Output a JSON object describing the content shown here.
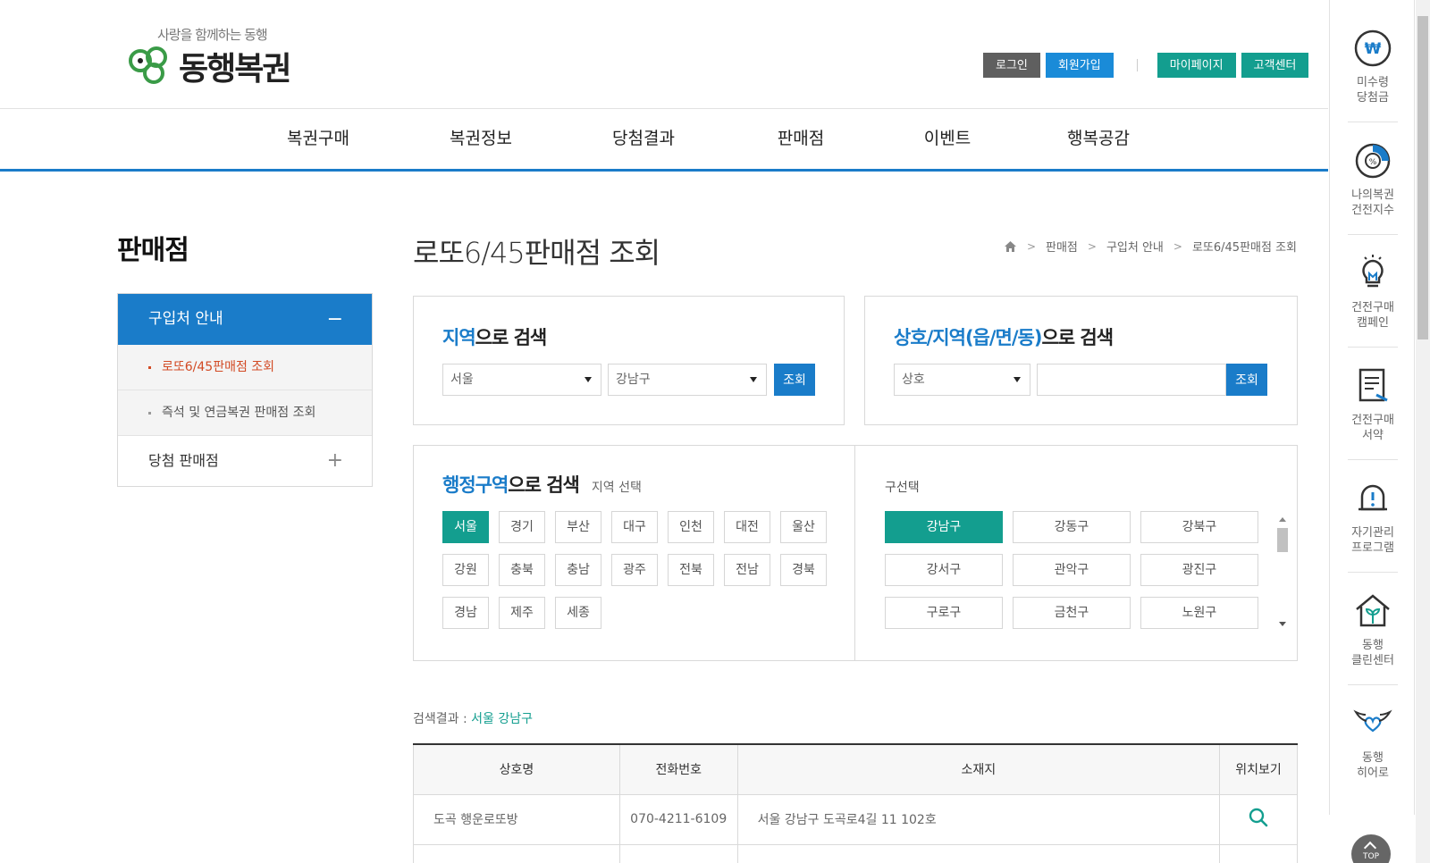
{
  "header": {
    "logo": {
      "slogan": "사랑을 함께하는 동행",
      "name": "동행복권"
    },
    "util": {
      "login": "로그인",
      "signup": "회원가입",
      "mypage": "마이페이지",
      "support": "고객센터"
    },
    "gnb": [
      "복권구매",
      "복권정보",
      "당첨결과",
      "판매점",
      "이벤트",
      "행복공감"
    ]
  },
  "sidebar": {
    "title": "판매점",
    "menu": {
      "head": "구입처 안내",
      "head_toggle": "−",
      "sub": [
        "로또6/45판매점 조회",
        "즉석 및 연금복권 판매점 조회"
      ],
      "row": "당첨 판매점",
      "row_toggle": "+"
    }
  },
  "content": {
    "title": "로또6/45판매점 조회",
    "breadcrumb": [
      "판매점",
      "구입처 안내",
      "로또6/45판매점 조회"
    ],
    "region_search": {
      "title_hl": "지역",
      "title_rest": "으로 검색",
      "sido": "서울",
      "gugun": "강남구",
      "button": "조회"
    },
    "name_search": {
      "title_hl": "상호/지역(읍/면/동)",
      "title_rest": "으로 검색",
      "type": "상호",
      "keyword": "",
      "button": "조회"
    },
    "admin_search": {
      "title_hl": "행정구역",
      "title_rest": "으로 검색",
      "sub": "지역 선택",
      "regions": [
        "서울",
        "경기",
        "부산",
        "대구",
        "인천",
        "대전",
        "울산",
        "강원",
        "충북",
        "충남",
        "광주",
        "전북",
        "전남",
        "경북",
        "경남",
        "제주",
        "세종"
      ],
      "selected_region": "서울",
      "district_title": "구선택",
      "districts": [
        "강남구",
        "강동구",
        "강북구",
        "강서구",
        "관악구",
        "광진구",
        "구로구",
        "금천구",
        "노원구"
      ],
      "selected_district": "강남구"
    },
    "result": {
      "label": "검색결과 : ",
      "value": "서울 강남구"
    },
    "table": {
      "headers": [
        "상호명",
        "전화번호",
        "소재지",
        "위치보기"
      ],
      "rows": [
        {
          "name": "도곡 행운로또방",
          "phone": "070-4211-6109",
          "address": "서울 강남구 도곡로4길 11 102호"
        }
      ]
    }
  },
  "quick_menu": {
    "items": [
      "미수령\n당첨금",
      "나의복권\n건전지수",
      "건전구매\n캠페인",
      "건전구매\n서약",
      "자기관리\n프로그램",
      "동행\n클린센터",
      "동행\n히어로"
    ],
    "top": "TOP"
  },
  "colors": {
    "primary": "#1a7cc9",
    "teal": "#139e8f",
    "accent_red": "#d24a24",
    "dark_button": "#5f5f5f"
  }
}
